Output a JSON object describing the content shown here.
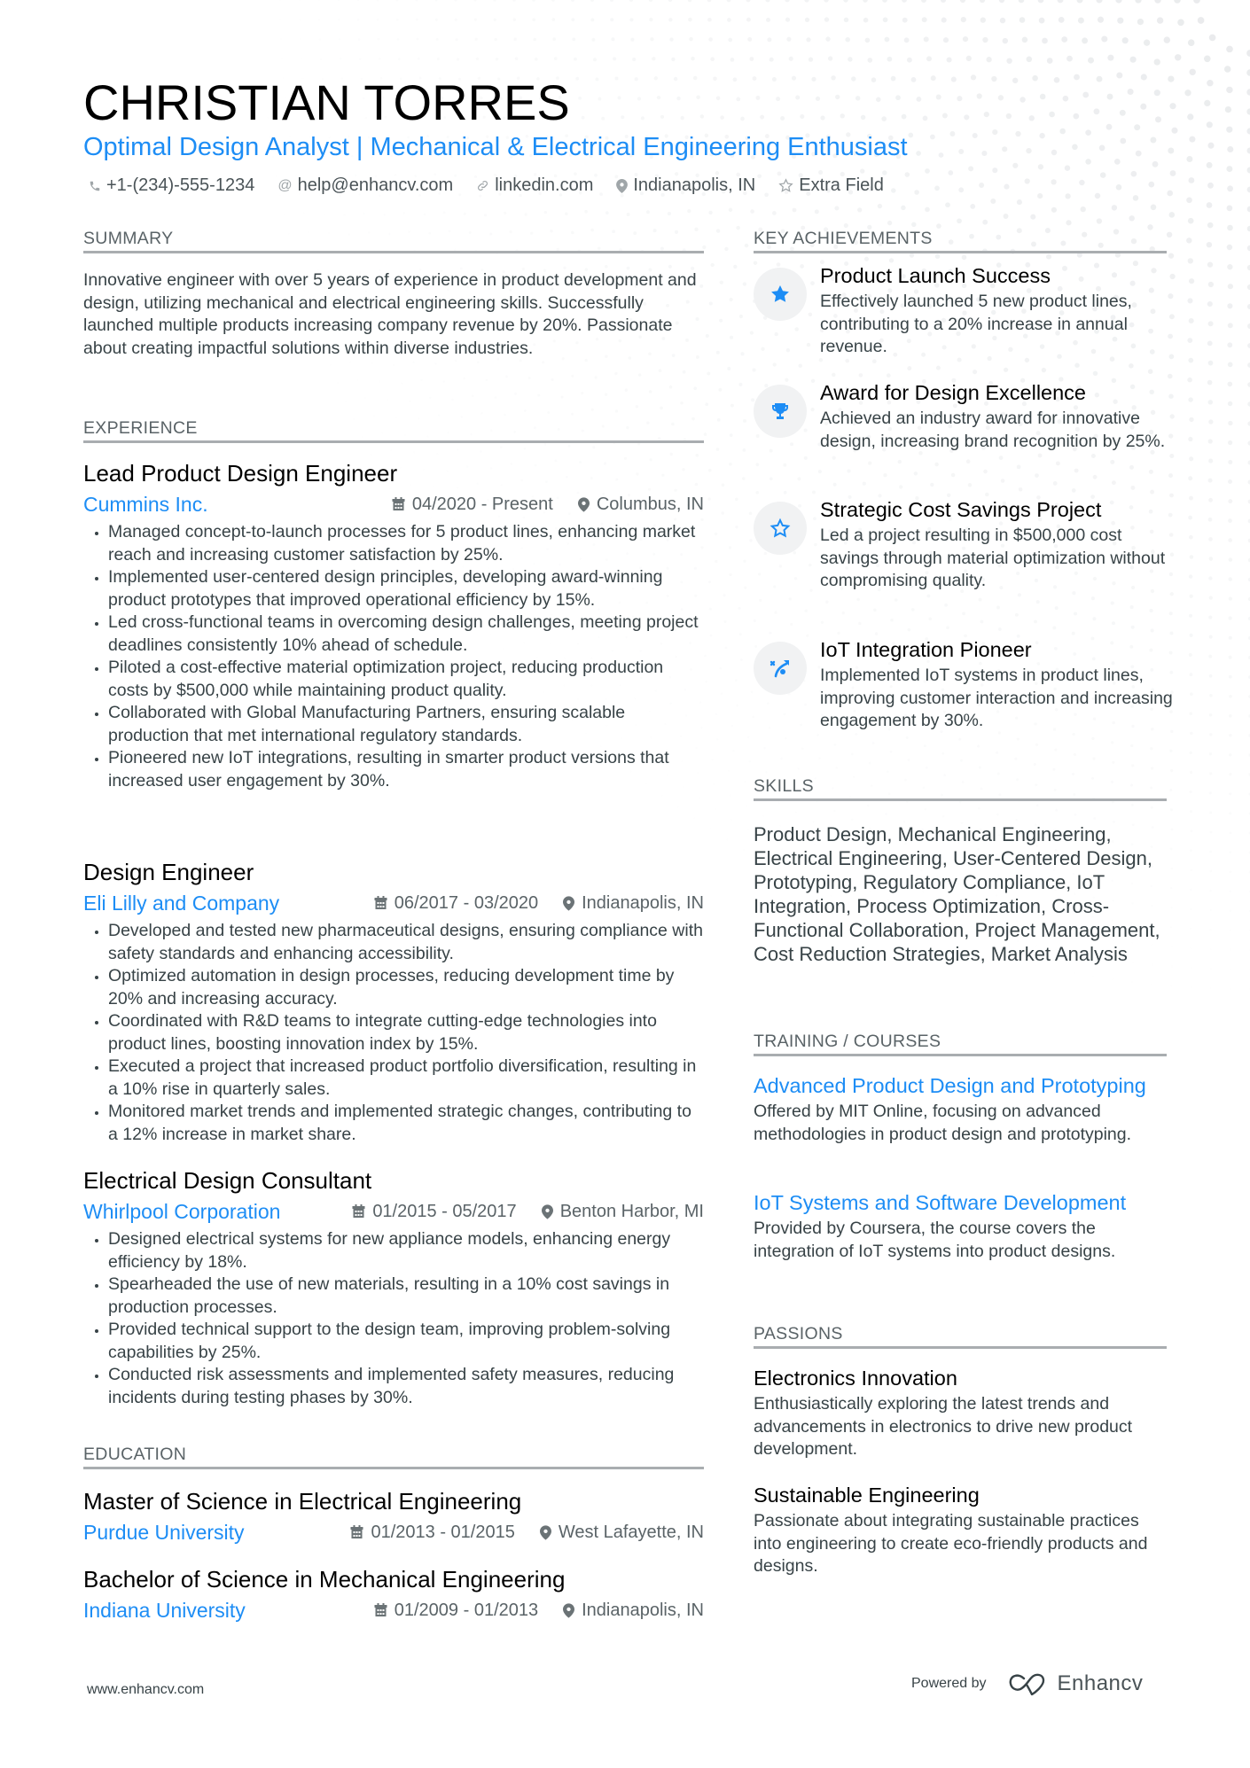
{
  "header": {
    "name": "CHRISTIAN TORRES",
    "title": "Optimal Design Analyst | Mechanical & Electrical Engineering Enthusiast",
    "contacts": [
      {
        "icon": "phone-icon",
        "text": "+1-(234)-555-1234"
      },
      {
        "icon": "at-icon",
        "text": "help@enhancv.com"
      },
      {
        "icon": "link-icon",
        "text": "linkedin.com"
      },
      {
        "icon": "location-icon",
        "text": "Indianapolis, IN"
      },
      {
        "icon": "star-outline-icon",
        "text": "Extra Field"
      }
    ]
  },
  "summary": {
    "heading": "SUMMARY",
    "text": "Innovative engineer with over 5 years of experience in product development and design, utilizing mechanical and electrical engineering skills. Successfully launched multiple products increasing company revenue by 20%. Passionate about creating impactful solutions within diverse industries."
  },
  "experience": {
    "heading": "EXPERIENCE",
    "jobs": [
      {
        "title": "Lead Product Design Engineer",
        "company": "Cummins Inc.",
        "dates": "04/2020 - Present",
        "location": "Columbus, IN",
        "bullets": [
          "Managed concept-to-launch processes for 5 product lines, enhancing market reach and increasing customer satisfaction by 25%.",
          "Implemented user-centered design principles, developing award-winning product prototypes that improved operational efficiency by 15%.",
          "Led cross-functional teams in overcoming design challenges, meeting project deadlines consistently 10% ahead of schedule.",
          "Piloted a cost-effective material optimization project, reducing production costs by $500,000 while maintaining product quality.",
          "Collaborated with Global Manufacturing Partners, ensuring scalable production that met international regulatory standards.",
          "Pioneered new IoT integrations, resulting in smarter product versions that increased user engagement by 30%."
        ]
      },
      {
        "title": "Design Engineer",
        "company": "Eli Lilly and Company",
        "dates": "06/2017 - 03/2020",
        "location": "Indianapolis, IN",
        "bullets": [
          "Developed and tested new pharmaceutical designs, ensuring compliance with safety standards and enhancing accessibility.",
          "Optimized automation in design processes, reducing development time by 20% and increasing accuracy.",
          "Coordinated with R&D teams to integrate cutting-edge technologies into product lines, boosting innovation index by 15%.",
          "Executed a project that increased product portfolio diversification, resulting in a 10% rise in quarterly sales.",
          "Monitored market trends and implemented strategic changes, contributing to a 12% increase in market share."
        ]
      },
      {
        "title": "Electrical Design Consultant",
        "company": "Whirlpool Corporation",
        "dates": "01/2015 - 05/2017",
        "location": "Benton Harbor, MI",
        "bullets": [
          "Designed electrical systems for new appliance models, enhancing energy efficiency by 18%.",
          "Spearheaded the use of new materials, resulting in a 10% cost savings in production processes.",
          "Provided technical support to the design team, improving problem-solving capabilities by 25%.",
          "Conducted risk assessments and implemented safety measures, reducing incidents during testing phases by 30%."
        ]
      }
    ]
  },
  "education": {
    "heading": "EDUCATION",
    "items": [
      {
        "degree": "Master of Science in Electrical Engineering",
        "school": "Purdue University",
        "dates": "01/2013 - 01/2015",
        "location": "West Lafayette, IN"
      },
      {
        "degree": "Bachelor of Science in Mechanical Engineering",
        "school": "Indiana University",
        "dates": "01/2009 - 01/2013",
        "location": "Indianapolis, IN"
      }
    ]
  },
  "achievements": {
    "heading": "KEY ACHIEVEMENTS",
    "items": [
      {
        "icon": "star-filled-icon",
        "title": "Product Launch Success",
        "desc": "Effectively launched 5 new product lines, contributing to a 20% increase in annual revenue."
      },
      {
        "icon": "trophy-icon",
        "title": "Award for Design Excellence",
        "desc": "Achieved an industry award for innovative design, increasing brand recognition by 25%."
      },
      {
        "icon": "star-outline-icon",
        "title": "Strategic Cost Savings Project",
        "desc": "Led a project resulting in $500,000 cost savings through material optimization without compromising quality."
      },
      {
        "icon": "strategy-icon",
        "title": "IoT Integration Pioneer",
        "desc": "Implemented IoT systems in product lines, improving customer interaction and increasing engagement by 30%."
      }
    ]
  },
  "skills": {
    "heading": "SKILLS",
    "text": "Product Design, Mechanical Engineering, Electrical Engineering, User-Centered Design, Prototyping, Regulatory Compliance, IoT Integration, Process Optimization, Cross-Functional Collaboration, Project Management, Cost Reduction Strategies, Market Analysis"
  },
  "training": {
    "heading": "TRAINING / COURSES",
    "items": [
      {
        "title": "Advanced Product Design and Prototyping",
        "desc": "Offered by MIT Online, focusing on advanced methodologies in product design and prototyping."
      },
      {
        "title": "IoT Systems and Software Development",
        "desc": "Provided by Coursera, the course covers the integration of IoT systems into product designs."
      }
    ]
  },
  "passions": {
    "heading": "PASSIONS",
    "items": [
      {
        "title": "Electronics Innovation",
        "desc": "Enthusiastically exploring the latest trends and advancements in electronics to drive new product development."
      },
      {
        "title": "Sustainable Engineering",
        "desc": "Passionate about integrating sustainable practices into engineering to create eco-friendly products and designs."
      }
    ]
  },
  "footer": {
    "url": "www.enhancv.com",
    "powered_by": "Powered by",
    "brand": "Enhancv"
  },
  "colors": {
    "accent": "#1d8df5",
    "heading_text": "#000000",
    "body_text": "#384347",
    "rule": "#a9adb0",
    "icon_bg": "#f1f2f3"
  }
}
